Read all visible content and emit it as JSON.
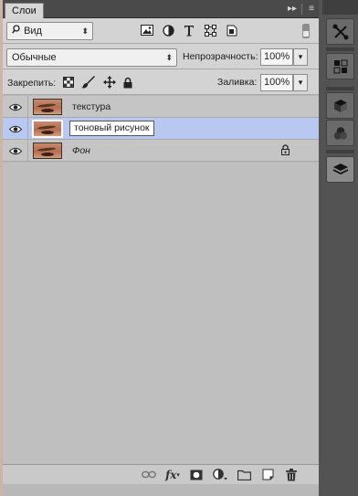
{
  "panel": {
    "tab_label": "Слои",
    "collapse_icon": "double-chevron-right-icon",
    "menu_icon": "panel-menu-icon"
  },
  "filter": {
    "kind_label": "Вид",
    "icons": [
      "pixel-layer-filter-icon",
      "adjustment-layer-filter-icon",
      "type-layer-filter-icon",
      "shape-layer-filter-icon",
      "smart-object-filter-icon"
    ]
  },
  "blend": {
    "mode": "Обычные",
    "opacity_label": "Непрозрачность:",
    "opacity_value": "100%"
  },
  "lock": {
    "label": "Закрепить:",
    "fill_label": "Заливка:",
    "fill_value": "100%"
  },
  "layers": [
    {
      "name": "текстура",
      "visible": true,
      "selected": false,
      "editing": false,
      "locked": false,
      "italic": false
    },
    {
      "name": "тоновый рисунок",
      "visible": true,
      "selected": true,
      "editing": true,
      "locked": false,
      "italic": false
    },
    {
      "name": "Фон",
      "visible": true,
      "selected": false,
      "editing": false,
      "locked": true,
      "italic": true
    }
  ],
  "bottom_bar": {
    "fx_label": "fx",
    "icons": [
      "link-layers-icon",
      "fx-icon",
      "layer-mask-icon",
      "adjustment-layer-icon",
      "new-group-icon",
      "new-layer-icon",
      "delete-layer-icon"
    ]
  },
  "dock": {
    "icons": [
      "tools-icon",
      "3d-icon",
      "cube-icon",
      "channels-icon",
      "layers-icon"
    ]
  }
}
